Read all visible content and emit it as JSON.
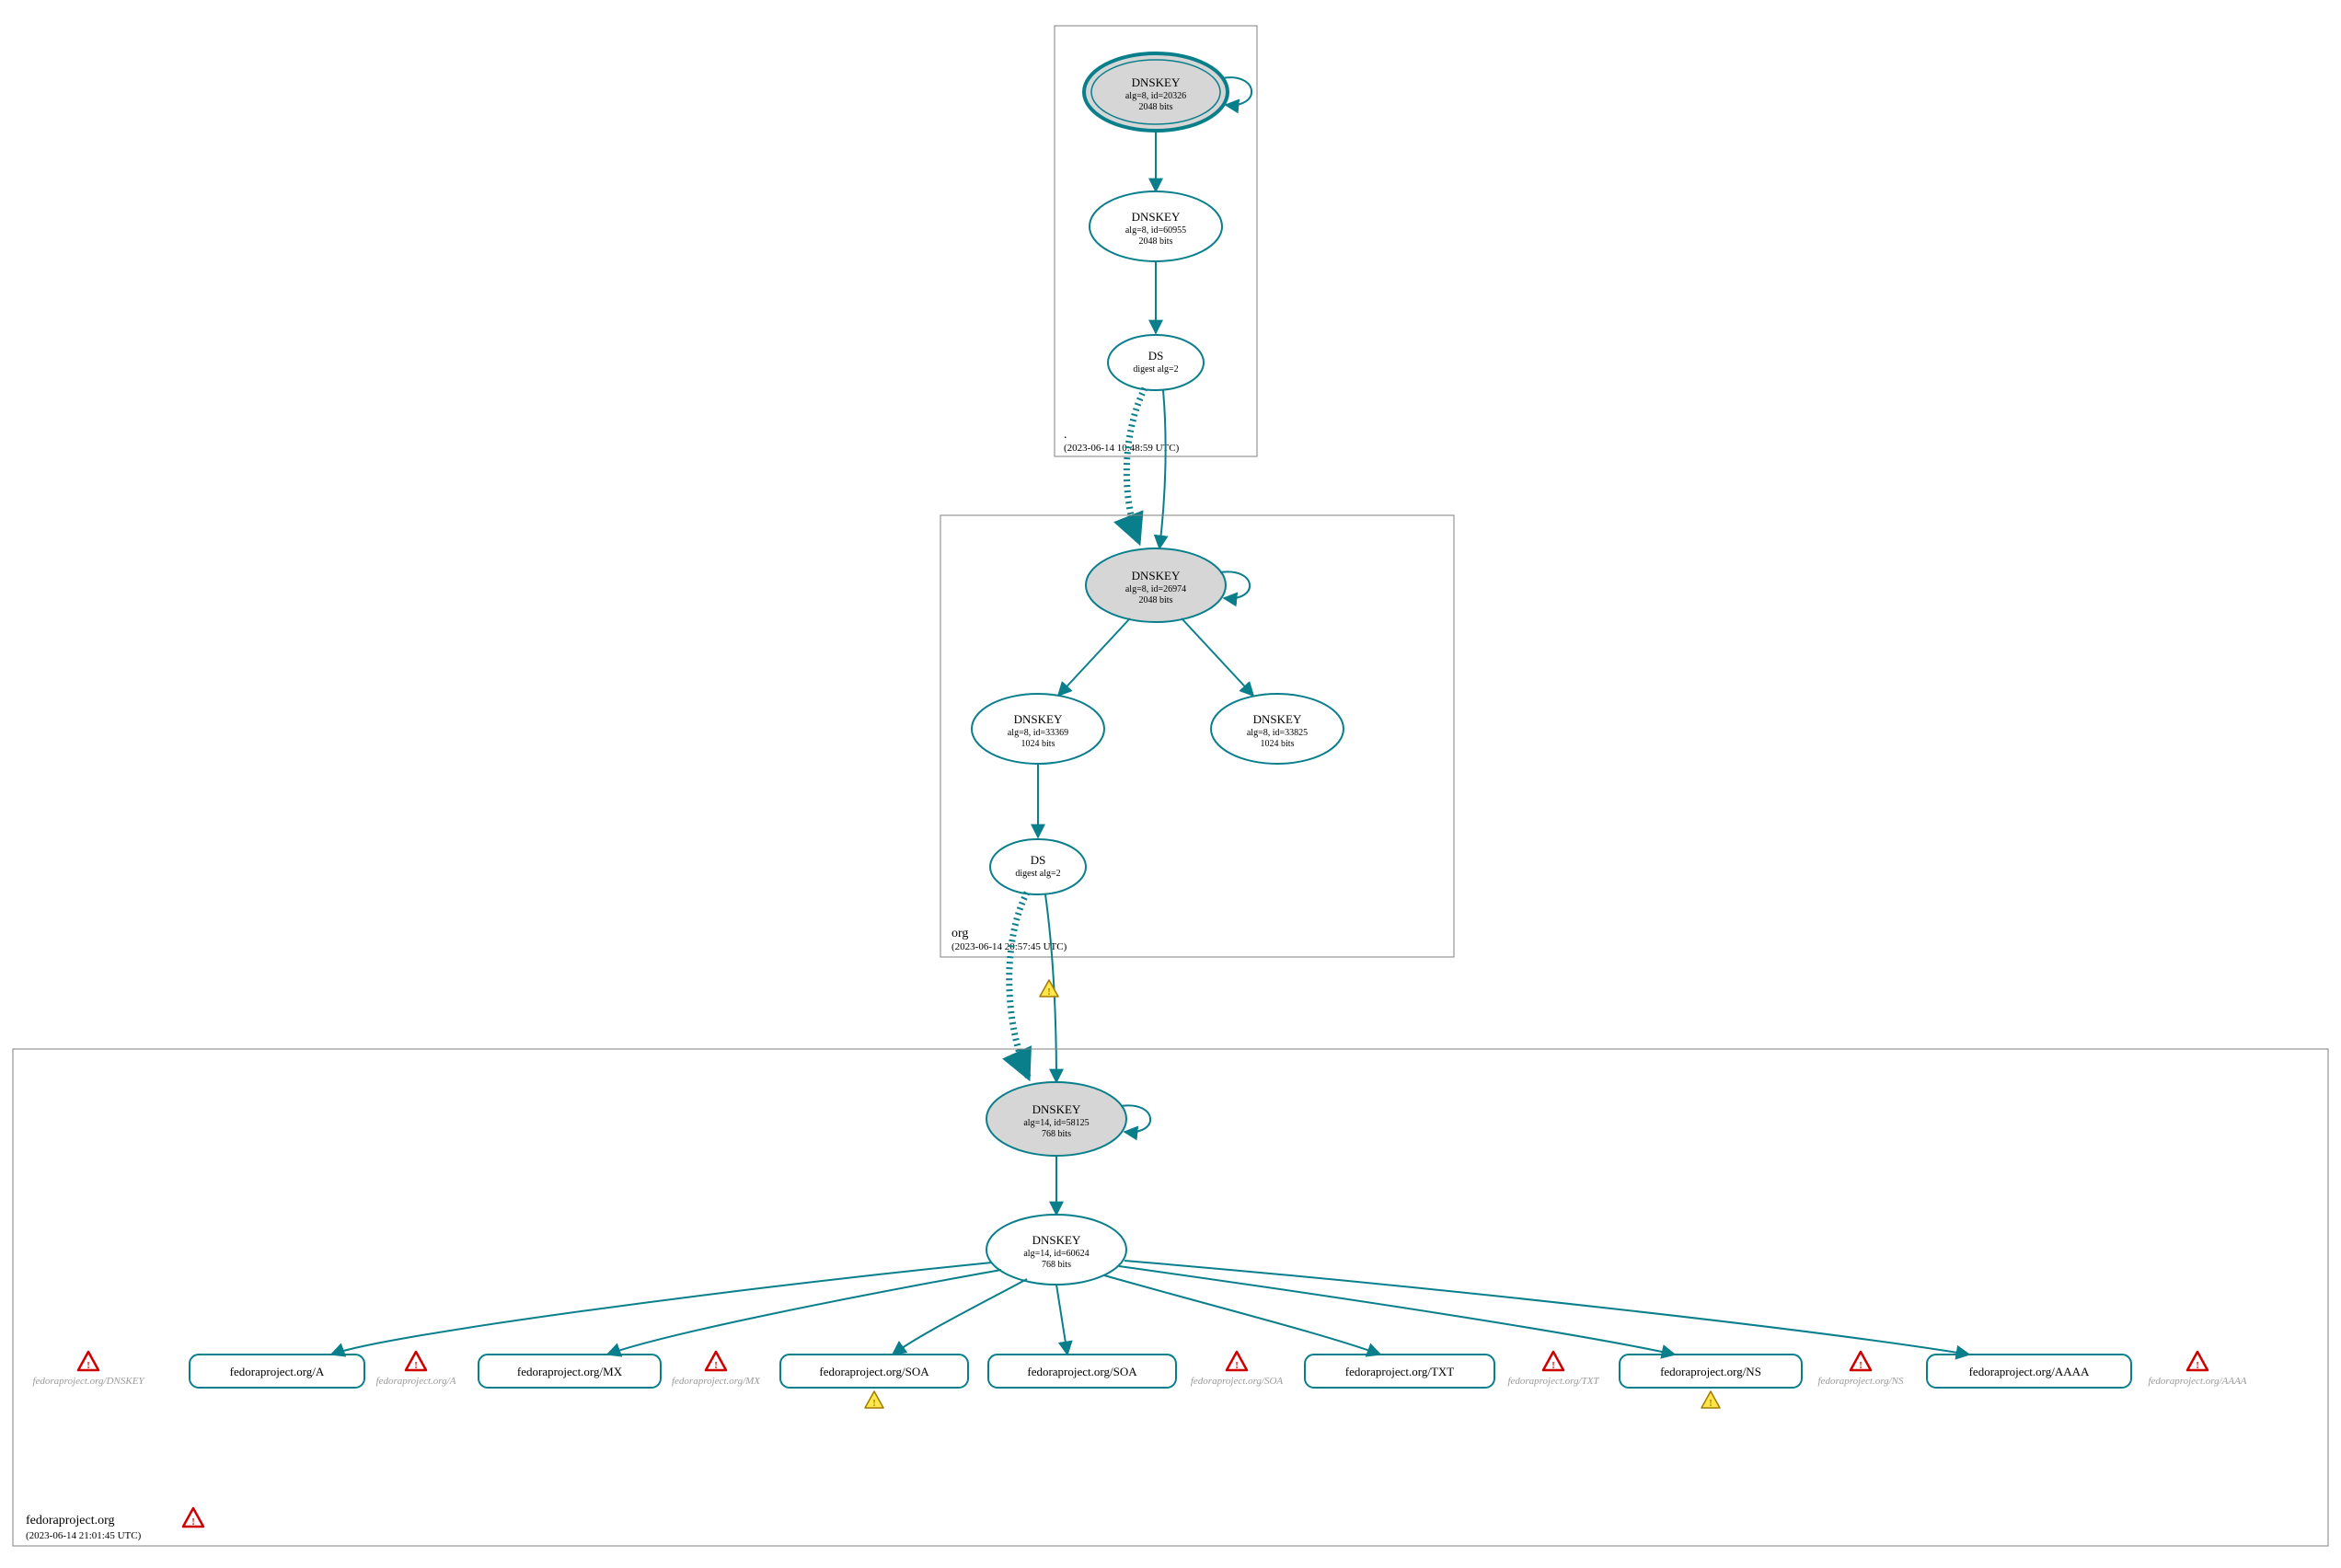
{
  "colors": {
    "stroke": "#0a7f8c",
    "zone_border": "#808080",
    "node_fill_gray": "#d6d6d6",
    "warn_fill": "#ffe74a",
    "warn_stroke": "#a07a00",
    "err_stroke": "#cc0000"
  },
  "chart_data": {
    "type": "hierarchy-graph",
    "zones": [
      {
        "id": "root",
        "label": ".",
        "timestamp": "(2023-06-14 10:48:59 UTC)",
        "has_error_icon": false
      },
      {
        "id": "org",
        "label": "org",
        "timestamp": "(2023-06-14 20:57:45 UTC)",
        "has_error_icon": false
      },
      {
        "id": "fedora",
        "label": "fedoraproject.org",
        "timestamp": "(2023-06-14 21:01:45 UTC)",
        "has_error_icon": true
      }
    ],
    "nodes": [
      {
        "id": "root_ksk",
        "zone": "root",
        "shape": "ellipse",
        "style": "trust-anchor",
        "title": "DNSKEY",
        "line2": "alg=8, id=20326",
        "line3": "2048 bits",
        "self_loop": true
      },
      {
        "id": "root_zsk",
        "zone": "root",
        "shape": "ellipse",
        "style": "white",
        "title": "DNSKEY",
        "line2": "alg=8, id=60955",
        "line3": "2048 bits",
        "self_loop": false
      },
      {
        "id": "root_ds",
        "zone": "root",
        "shape": "ellipse",
        "style": "white",
        "title": "DS",
        "line2": "digest alg=2",
        "line3": "",
        "self_loop": false
      },
      {
        "id": "org_ksk",
        "zone": "org",
        "shape": "ellipse",
        "style": "gray",
        "title": "DNSKEY",
        "line2": "alg=8, id=26974",
        "line3": "2048 bits",
        "self_loop": true
      },
      {
        "id": "org_zsk1",
        "zone": "org",
        "shape": "ellipse",
        "style": "white",
        "title": "DNSKEY",
        "line2": "alg=8, id=33369",
        "line3": "1024 bits",
        "self_loop": false
      },
      {
        "id": "org_zsk2",
        "zone": "org",
        "shape": "ellipse",
        "style": "white",
        "title": "DNSKEY",
        "line2": "alg=8, id=33825",
        "line3": "1024 bits",
        "self_loop": false
      },
      {
        "id": "org_ds",
        "zone": "org",
        "shape": "ellipse",
        "style": "white",
        "title": "DS",
        "line2": "digest alg=2",
        "line3": "",
        "self_loop": false
      },
      {
        "id": "fed_ksk",
        "zone": "fedora",
        "shape": "ellipse",
        "style": "gray",
        "title": "DNSKEY",
        "line2": "alg=14, id=58125",
        "line3": "768 bits",
        "self_loop": true
      },
      {
        "id": "fed_zsk",
        "zone": "fedora",
        "shape": "ellipse",
        "style": "white",
        "title": "DNSKEY",
        "line2": "alg=14, id=60624",
        "line3": "768 bits",
        "self_loop": false
      },
      {
        "id": "gray_dnskey",
        "zone": "fedora",
        "shape": "graytext",
        "label": "fedoraproject.org/DNSKEY",
        "has_error_icon": true
      },
      {
        "id": "rr_a",
        "zone": "fedora",
        "shape": "rrset",
        "label": "fedoraproject.org/A",
        "warn_below": false
      },
      {
        "id": "gray_a",
        "zone": "fedora",
        "shape": "graytext",
        "label": "fedoraproject.org/A",
        "has_error_icon": true
      },
      {
        "id": "rr_mx",
        "zone": "fedora",
        "shape": "rrset",
        "label": "fedoraproject.org/MX",
        "warn_below": false
      },
      {
        "id": "gray_mx",
        "zone": "fedora",
        "shape": "graytext",
        "label": "fedoraproject.org/MX",
        "has_error_icon": true
      },
      {
        "id": "rr_soa1",
        "zone": "fedora",
        "shape": "rrset",
        "label": "fedoraproject.org/SOA",
        "warn_below": true
      },
      {
        "id": "rr_soa2",
        "zone": "fedora",
        "shape": "rrset",
        "label": "fedoraproject.org/SOA",
        "warn_below": false
      },
      {
        "id": "gray_soa",
        "zone": "fedora",
        "shape": "graytext",
        "label": "fedoraproject.org/SOA",
        "has_error_icon": true
      },
      {
        "id": "rr_txt",
        "zone": "fedora",
        "shape": "rrset",
        "label": "fedoraproject.org/TXT",
        "warn_below": false
      },
      {
        "id": "gray_txt",
        "zone": "fedora",
        "shape": "graytext",
        "label": "fedoraproject.org/TXT",
        "has_error_icon": true
      },
      {
        "id": "rr_ns",
        "zone": "fedora",
        "shape": "rrset",
        "label": "fedoraproject.org/NS",
        "warn_below": true
      },
      {
        "id": "gray_ns",
        "zone": "fedora",
        "shape": "graytext",
        "label": "fedoraproject.org/NS",
        "has_error_icon": true
      },
      {
        "id": "rr_aaaa",
        "zone": "fedora",
        "shape": "rrset",
        "label": "fedoraproject.org/AAAA",
        "warn_below": false
      },
      {
        "id": "gray_aaaa",
        "zone": "fedora",
        "shape": "graytext",
        "label": "fedoraproject.org/AAAA",
        "has_error_icon": true
      }
    ],
    "edges": [
      {
        "from": "root_ksk",
        "to": "root_zsk",
        "style": "solid"
      },
      {
        "from": "root_zsk",
        "to": "root_ds",
        "style": "solid"
      },
      {
        "from": "root_ds",
        "to": "org_ksk",
        "style": "solid"
      },
      {
        "from": "root_ds",
        "to": "org_ksk",
        "style": "dashed",
        "side": "left"
      },
      {
        "from": "org_ksk",
        "to": "org_zsk1",
        "style": "solid"
      },
      {
        "from": "org_ksk",
        "to": "org_zsk2",
        "style": "solid"
      },
      {
        "from": "org_zsk1",
        "to": "org_ds",
        "style": "solid"
      },
      {
        "from": "org_ds",
        "to": "fed_ksk",
        "style": "solid"
      },
      {
        "from": "org_ds",
        "to": "fed_ksk",
        "style": "dashed",
        "side": "left",
        "has_warn": true
      },
      {
        "from": "fed_ksk",
        "to": "fed_zsk",
        "style": "solid"
      },
      {
        "from": "fed_zsk",
        "to": "rr_a",
        "style": "solid"
      },
      {
        "from": "fed_zsk",
        "to": "rr_mx",
        "style": "solid"
      },
      {
        "from": "fed_zsk",
        "to": "rr_soa1",
        "style": "solid"
      },
      {
        "from": "fed_zsk",
        "to": "rr_soa2",
        "style": "solid"
      },
      {
        "from": "fed_zsk",
        "to": "rr_txt",
        "style": "solid"
      },
      {
        "from": "fed_zsk",
        "to": "rr_ns",
        "style": "solid"
      },
      {
        "from": "fed_zsk",
        "to": "rr_aaaa",
        "style": "solid"
      }
    ]
  }
}
